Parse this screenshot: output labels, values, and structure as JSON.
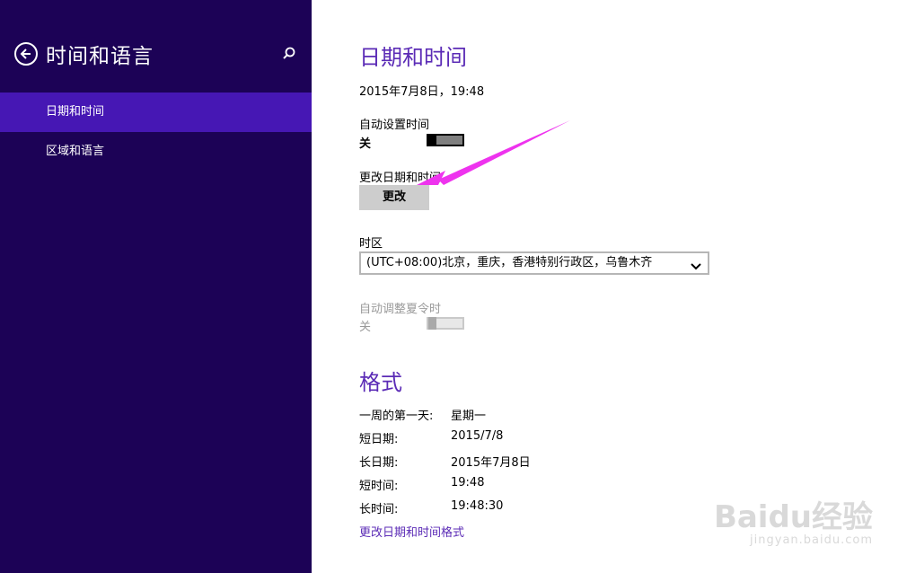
{
  "sidebar": {
    "title": "时间和语言",
    "items": [
      {
        "label": "日期和时间",
        "active": true
      },
      {
        "label": "区域和语言",
        "active": false
      }
    ]
  },
  "datetime": {
    "heading": "日期和时间",
    "current": "2015年7月8日，19:48",
    "auto_time_label": "自动设置时间",
    "auto_time_state": "关",
    "change_label": "更改日期和时间",
    "change_button": "更改",
    "timezone_label": "时区",
    "timezone_value": "(UTC+08:00)北京，重庆，香港特别行政区，乌鲁木齐",
    "dst_label": "自动调整夏令时",
    "dst_state": "关"
  },
  "formats": {
    "heading": "格式",
    "rows": [
      {
        "label": "一周的第一天:",
        "value": "星期一"
      },
      {
        "label": "短日期:",
        "value": "2015/7/8"
      },
      {
        "label": "长日期:",
        "value": "2015年7月8日"
      },
      {
        "label": "短时间:",
        "value": "19:48"
      },
      {
        "label": "长时间:",
        "value": "19:48:30"
      }
    ],
    "link": "更改日期和时间格式"
  },
  "watermark": {
    "logo": "Baidu经验",
    "url": "jingyan.baidu.com"
  },
  "colors": {
    "sidebar_bg": "#1c0256",
    "sidebar_active": "#4617b4",
    "accent": "#5b2bb6",
    "annotation_arrow": "#ee33ee"
  },
  "icons": {
    "back": "back-arrow-icon",
    "search": "search-icon",
    "dropdown": "chevron-down-icon"
  }
}
